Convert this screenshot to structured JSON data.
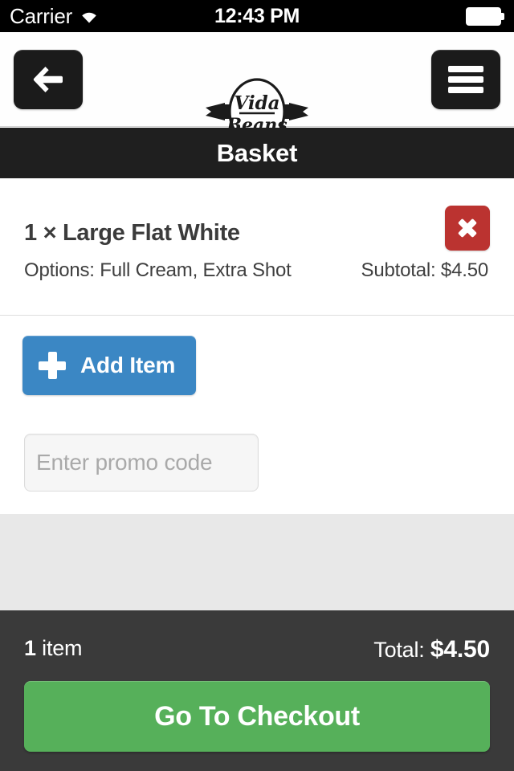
{
  "status_bar": {
    "carrier": "Carrier",
    "wifi_icon": "wifi-icon",
    "time": "12:43 PM",
    "battery_icon": "battery-full-icon"
  },
  "header": {
    "back_icon": "arrow-left-icon",
    "menu_icon": "hamburger-menu-icon",
    "logo": {
      "name": "vida-beans-logo",
      "line1": "Vida",
      "line2": "Beans"
    }
  },
  "page": {
    "title": "Basket"
  },
  "basket": {
    "items": [
      {
        "title": "1 × Large Flat White",
        "options": "Options: Full Cream, Extra Shot",
        "subtotal": "Subtotal: $4.50",
        "remove_icon": "close-x-icon"
      }
    ],
    "add_item_label": "Add Item",
    "add_item_icon": "plus-icon",
    "promo_placeholder": "Enter promo code",
    "promo_value": ""
  },
  "footer": {
    "count_number": "1",
    "count_label": "item",
    "total_label": "Total:",
    "total_value": "$4.50",
    "checkout_label": "Go To Checkout"
  },
  "colors": {
    "status_bar_bg": "#000000",
    "title_bar_bg": "#1f1f1f",
    "icon_button_bg": "#1b1b1b",
    "remove_red": "#bb3330",
    "add_blue": "#3b87c4",
    "checkout_green": "#56b05a",
    "footer_bg": "#3a3a3a",
    "spacer_grey": "#e8e8e8",
    "text_dark": "#3b3b3b",
    "placeholder_grey": "#a9a9a9"
  }
}
